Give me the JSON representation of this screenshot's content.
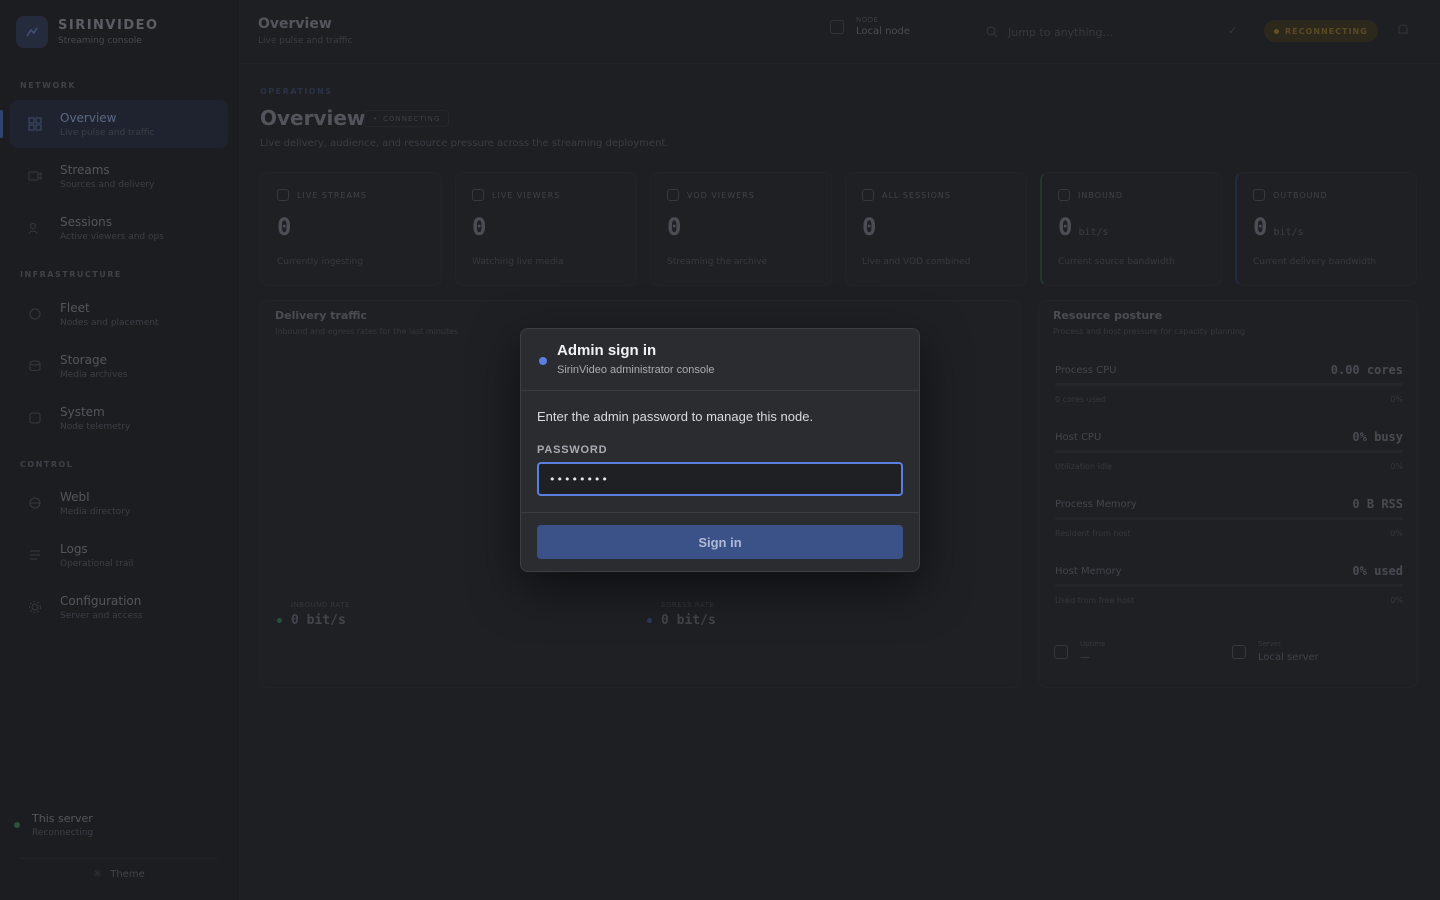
{
  "brand": {
    "name": "SIRINVIDEO",
    "subtitle": "Streaming console"
  },
  "sidebar": {
    "sections": [
      "NETWORK",
      "INFRASTRUCTURE",
      "CONTROL"
    ],
    "items": [
      {
        "title": "Overview",
        "subtitle": "Live pulse and traffic",
        "icon": "grid-icon"
      },
      {
        "title": "Streams",
        "subtitle": "Sources and delivery",
        "icon": "stream-icon"
      },
      {
        "title": "Sessions",
        "subtitle": "Active viewers and ops",
        "icon": "users-icon"
      },
      {
        "title": "Fleet",
        "subtitle": "Nodes and placement",
        "icon": "fleet-icon"
      },
      {
        "title": "Storage",
        "subtitle": "Media archives",
        "icon": "storage-icon"
      },
      {
        "title": "System",
        "subtitle": "Node telemetry",
        "icon": "system-icon"
      },
      {
        "title": "WebI",
        "subtitle": "Media directory",
        "icon": "web-icon"
      },
      {
        "title": "Logs",
        "subtitle": "Operational trail",
        "icon": "logs-icon"
      },
      {
        "title": "Configuration",
        "subtitle": "Server and access",
        "icon": "config-icon"
      }
    ],
    "server": {
      "title": "This server",
      "subtitle": "Reconnecting"
    },
    "theme_label": "Theme"
  },
  "header": {
    "title": "Overview",
    "subtitle": "Live pulse and traffic",
    "node_label": "NODE",
    "node_value": "Local node",
    "search_placeholder": "Jump to anything...",
    "status": "RECONNECTING"
  },
  "main": {
    "eyebrow": "OPERATIONS",
    "title": "Overview",
    "chip": "CONNECTING",
    "description": "Live delivery, audience, and resource pressure across the streaming deployment.",
    "stats": [
      {
        "label": "LIVE STREAMS",
        "value": "0",
        "unit": "",
        "foot": "Currently ingesting"
      },
      {
        "label": "LIVE VIEWERS",
        "value": "0",
        "unit": "",
        "foot": "Watching live media"
      },
      {
        "label": "VOD VIEWERS",
        "value": "0",
        "unit": "",
        "foot": "Streaming the archive"
      },
      {
        "label": "ALL SESSIONS",
        "value": "0",
        "unit": "",
        "foot": "Live and VOD combined"
      },
      {
        "label": "INBOUND",
        "value": "0",
        "unit": "bit/s",
        "foot": "Current source bandwidth"
      },
      {
        "label": "OUTBOUND",
        "value": "0",
        "unit": "bit/s",
        "foot": "Current delivery bandwidth"
      }
    ],
    "traffic": {
      "title": "Delivery traffic",
      "subtitle": "Inbound and egress rates for the last minutes",
      "inbound_label": "INBOUND RATE",
      "inbound_value": "0 bit/s",
      "outbound_label": "EGRESS RATE",
      "outbound_value": "0 bit/s",
      "inbound_color": "#2f7a4f",
      "outbound_color": "#3a4f86"
    },
    "resources": {
      "title": "Resource posture",
      "subtitle": "Process and host pressure for capacity planning",
      "rows": [
        {
          "name": "Process CPU",
          "value": "0.00 cores",
          "detail": "0 cores used",
          "pct": "0%"
        },
        {
          "name": "Host CPU",
          "value": "0% busy",
          "detail": "Utilization idle",
          "pct": "0%"
        },
        {
          "name": "Process Memory",
          "value": "0 B RSS",
          "detail": "Resident from host",
          "pct": "0%"
        },
        {
          "name": "Host Memory",
          "value": "0% used",
          "detail": "Used from free host",
          "pct": "0%"
        }
      ],
      "uptime_label": "Uptime",
      "uptime_value": "—",
      "server_label": "Server",
      "server_value": "Local server"
    }
  },
  "modal": {
    "title": "Admin sign in",
    "subtitle": "SirinVideo administrator console",
    "message": "Enter the admin password to manage this node.",
    "field_label": "PASSWORD",
    "password_value": "••••••••",
    "button_label": "Sign in",
    "accent": "#5a7fe0"
  }
}
